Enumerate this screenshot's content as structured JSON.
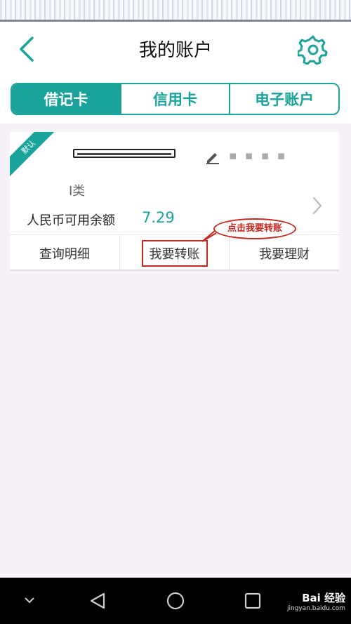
{
  "header": {
    "title": "我的账户"
  },
  "tabs": [
    {
      "label": "借记卡",
      "active": true
    },
    {
      "label": "信用卡",
      "active": false
    },
    {
      "label": "电子账户",
      "active": false
    }
  ],
  "card": {
    "default_tag": "默认",
    "account_class": "Ⅰ类",
    "balance_label": "人民币可用余额",
    "balance_value": "7.29",
    "actions": [
      "查询明细",
      "我要转账",
      "我要理财"
    ]
  },
  "annotation": {
    "callout_text": "点击我要转账"
  },
  "watermark": {
    "brand": "Bai 经验",
    "domain": "jingyan.baidu.com"
  },
  "colors": {
    "accent": "#1aa39a",
    "annotation_red": "#c4281f",
    "background": "#f6f0f7"
  }
}
